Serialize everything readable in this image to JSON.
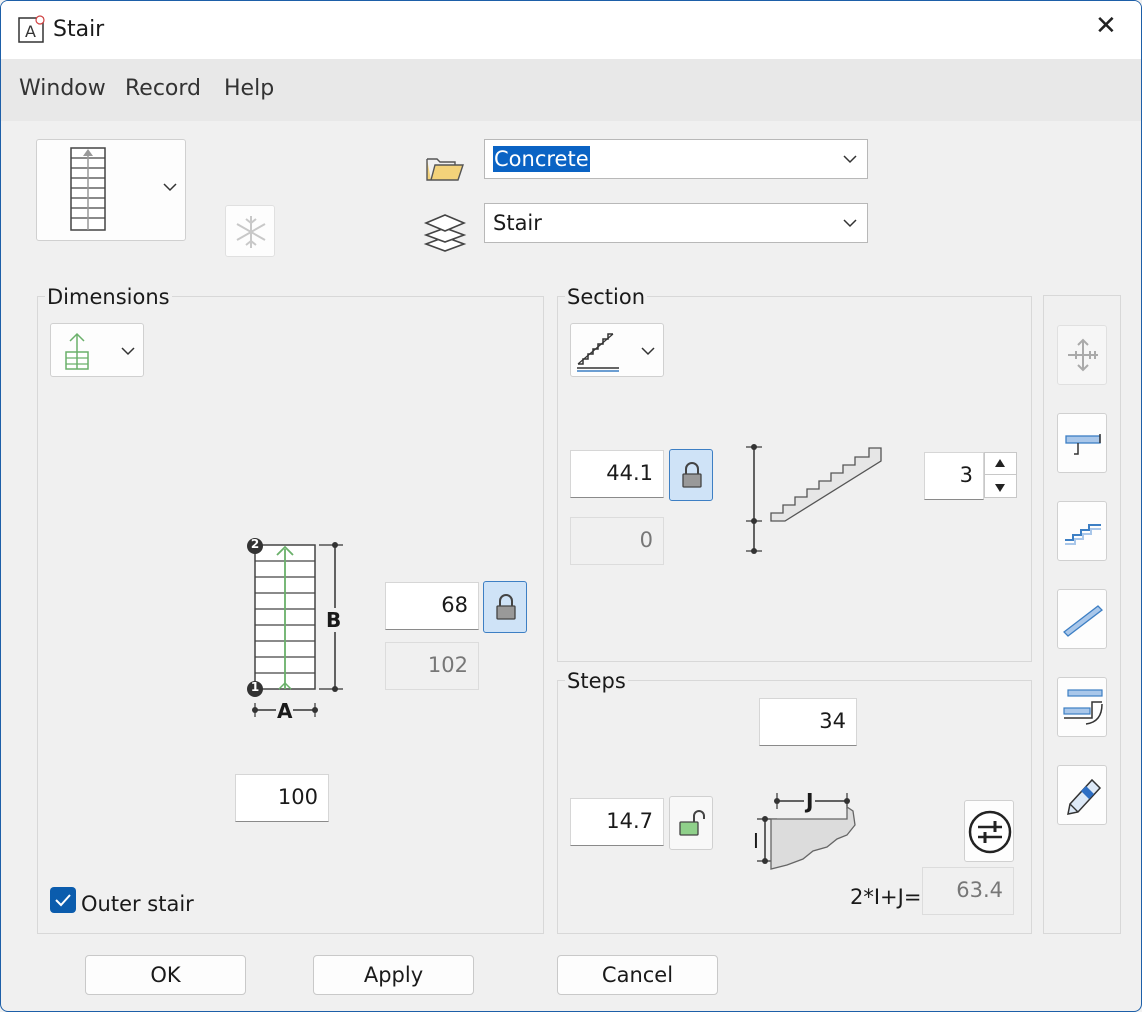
{
  "window": {
    "title": "Stair",
    "close_glyph": "✕"
  },
  "menu": {
    "items": [
      "Window",
      "Record",
      "Help"
    ]
  },
  "top": {
    "material": "Concrete",
    "layer": "Stair"
  },
  "dimensions": {
    "label": "Dimensions",
    "value_b": "68",
    "value_b_calc": "102",
    "value_a": "100",
    "outer_stair_label": "Outer stair",
    "outer_stair_checked": true,
    "marker_a": "A",
    "marker_b": "B",
    "marker_1": "1",
    "marker_2": "2"
  },
  "section": {
    "label": "Section",
    "angle": "44.1",
    "offset": "0",
    "count": "3"
  },
  "steps": {
    "label": "Steps",
    "count": "34",
    "height": "14.7",
    "formula_label": "2*I+J=",
    "formula_value": "63.4",
    "marker_j": "J",
    "marker_i": "I"
  },
  "buttons": {
    "ok": "OK",
    "apply": "Apply",
    "cancel": "Cancel"
  },
  "colors": {
    "accent": "#0b5cad",
    "selection": "#0a63c4",
    "green": "#6ab06a",
    "lock_bg": "#cfe3f7"
  }
}
